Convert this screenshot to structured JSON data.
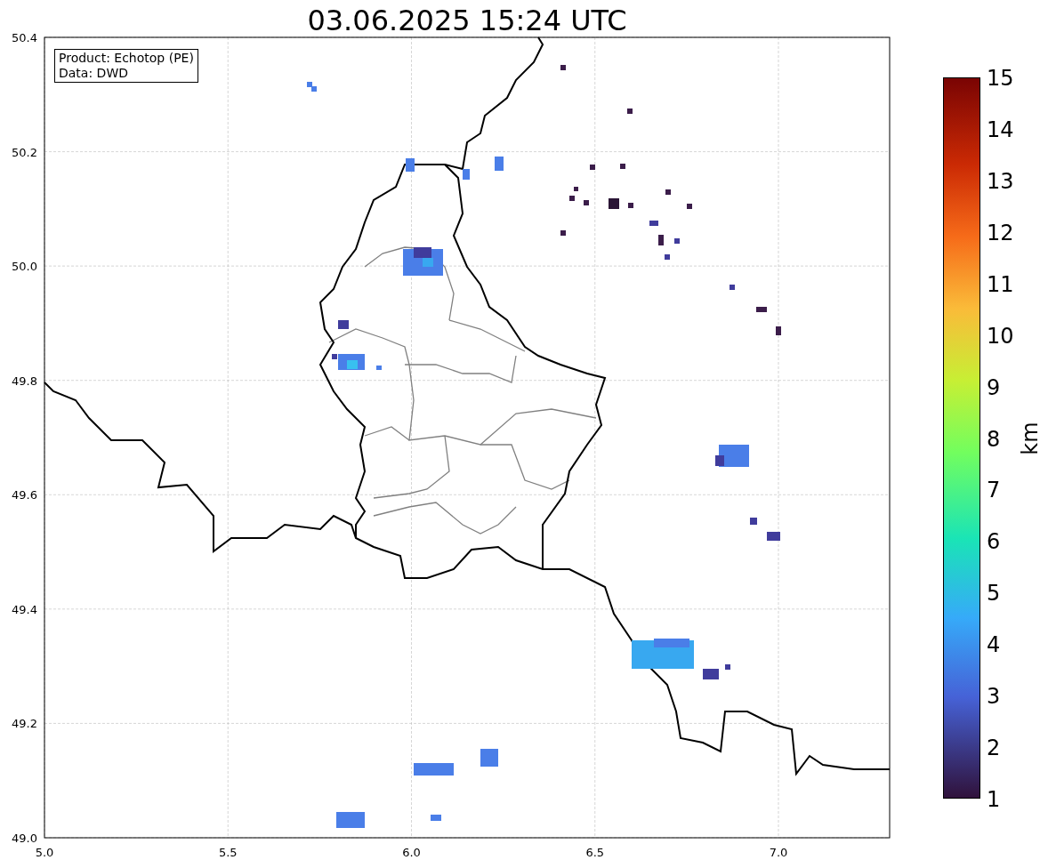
{
  "title": "03.06.2025 15:24 UTC",
  "legend": [
    "Product: Echotop (PE)",
    "Data: DWD"
  ],
  "axes": {
    "xticks": [
      "5.0",
      "5.5",
      "6.0",
      "6.5",
      "7.0"
    ],
    "yticks": [
      "50.4",
      "50.2",
      "50.0",
      "49.8",
      "49.6",
      "49.4",
      "49.2",
      "49.0"
    ]
  },
  "colorbar": {
    "label": "km",
    "ticks": [
      "15",
      "14",
      "13",
      "12",
      "11",
      "10",
      "9",
      "8",
      "7",
      "6",
      "5",
      "4",
      "3",
      "2",
      "1"
    ]
  }
}
